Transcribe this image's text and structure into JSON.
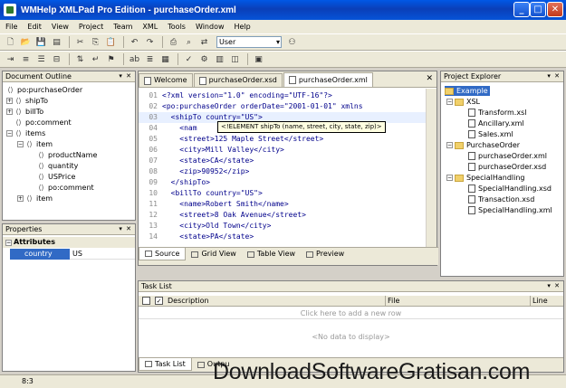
{
  "window": {
    "title": "WMHelp XMLPad Pro Edition - purchaseOrder.xml"
  },
  "menu": [
    "File",
    "Edit",
    "View",
    "Project",
    "Team",
    "XML",
    "Tools",
    "Window",
    "Help"
  ],
  "toolbar": {
    "user_combo": "User"
  },
  "outline": {
    "title": "Document Outline",
    "nodes": [
      "po:purchaseOrder",
      "shipTo",
      "billTo",
      "po:comment",
      "items",
      "item",
      "productName",
      "quantity",
      "USPrice",
      "po:comment",
      "item"
    ]
  },
  "properties": {
    "title": "Properties",
    "section": "Attributes",
    "row": {
      "name": "country",
      "value": "US"
    }
  },
  "editor": {
    "tabs": [
      "Welcome",
      "purchaseOrder.xsd",
      "purchaseOrder.xml"
    ],
    "lines": [
      {
        "n": "01",
        "text": "<?xml version=\"1.0\" encoding=\"UTF-16\"?>"
      },
      {
        "n": "02",
        "text": "<po:purchaseOrder orderDate=\"2001-01-01\" xmlns"
      },
      {
        "n": "03",
        "text": "  <shipTo country=\"US\">"
      },
      {
        "n": "04",
        "text": "    <nam"
      },
      {
        "n": "05",
        "text": "    <street>125 Maple Street</street>"
      },
      {
        "n": "06",
        "text": "    <city>Mill Valley</city>"
      },
      {
        "n": "07",
        "text": "    <state>CA</state>"
      },
      {
        "n": "08",
        "text": "    <zip>90952</zip>"
      },
      {
        "n": "09",
        "text": "  </shipTo>"
      },
      {
        "n": "10",
        "text": "  <billTo country=\"US\">"
      },
      {
        "n": "11",
        "text": "    <name>Robert Smith</name>"
      },
      {
        "n": "12",
        "text": "    <street>8 Oak Avenue</street>"
      },
      {
        "n": "13",
        "text": "    <city>Old Town</city>"
      },
      {
        "n": "14",
        "text": "    <state>PA</state>"
      }
    ],
    "tooltip": "<!ELEMENT shipTo (name, street, city, state, zip)>",
    "view_tabs": [
      "Source",
      "Grid View",
      "Table View",
      "Preview"
    ]
  },
  "project": {
    "title": "Project Explorer",
    "nodes": [
      "Example",
      "XSL",
      "Transform.xsl",
      "Ancillary.xml",
      "Sales.xml",
      "PurchaseOrder",
      "purchaseOrder.xml",
      "purchaseOrder.xsd",
      "SpecialHandling",
      "SpecialHandling.xsd",
      "Transaction.xsd",
      "SpecialHandling.xml"
    ]
  },
  "tasklist": {
    "title": "Task List",
    "columns": [
      "Description",
      "File",
      "Line"
    ],
    "add_row": "Click here to add a new row",
    "empty": "<No data to display>",
    "tabs": [
      "Task List",
      "Outpu"
    ]
  },
  "status": {
    "position": "8:3"
  },
  "watermark": "DownloadSoftwareGratisan.com"
}
